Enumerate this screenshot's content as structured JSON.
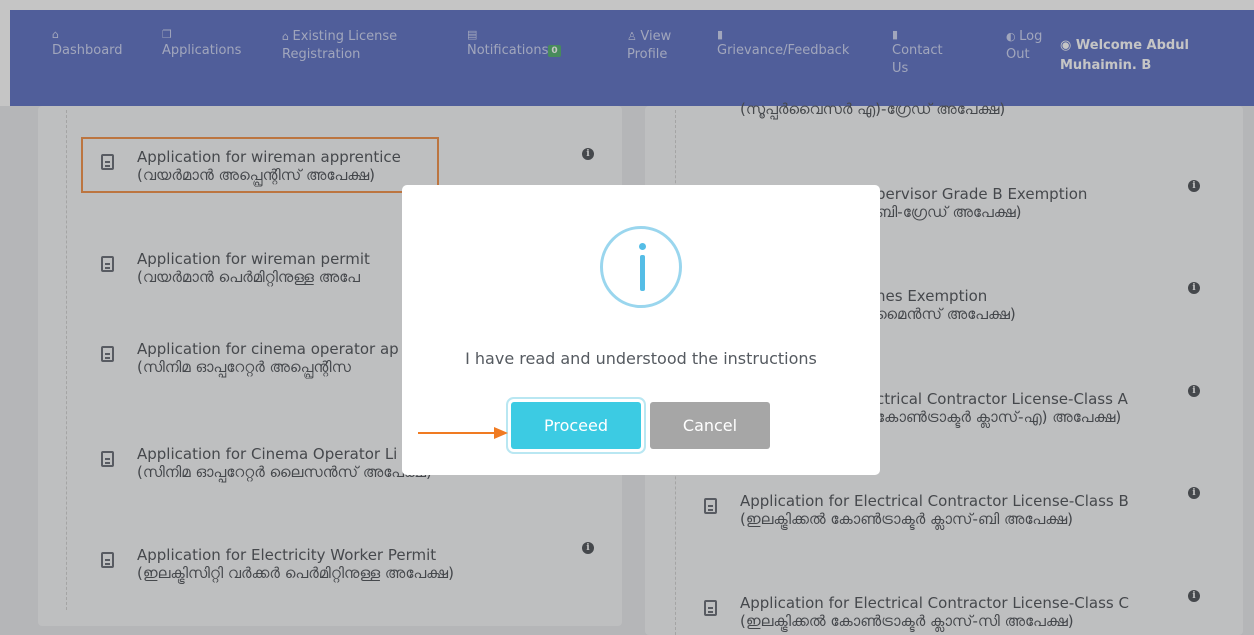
{
  "nav": {
    "dashboard": "Dashboard",
    "applications": "Applications",
    "existing_license": [
      "Existing License",
      "Registration"
    ],
    "notifications": "Notifications",
    "notifications_count": "0",
    "view_profile": [
      "View",
      "Profile"
    ],
    "grievance": "Grievance/Feedback",
    "contact": [
      "Contact",
      "Us"
    ],
    "logout": [
      "Log",
      "Out"
    ],
    "welcome": [
      "Welcome Abdul",
      "Muhaimin. B"
    ]
  },
  "left_items": [
    {
      "en": "Application for wireman apprentice",
      "ml": "(വയർമാൻ അപ്പ്രെന്റിസ് അപേക്ഷ)"
    },
    {
      "en": "Application for wireman permit",
      "ml": "(വയർമാൻ പെർമിറ്റിനുള്ള അപേ"
    },
    {
      "en": "Application for cinema operator ap",
      "ml": "(സിനിമ ഓപ്പറേറ്റർ അപ്പ്രെന്റിസ"
    },
    {
      "en": "Application for Cinema Operator Li",
      "ml": "(സിനിമ ഓപ്പറേറ്റർ ലൈസൻസ് അപേക്ഷ)"
    },
    {
      "en": "Application for Electricity Worker Permit",
      "ml": "(ഇലക്ട്രിസിറ്റി വർക്കർ പെർമിറ്റിനുള്ള അപേക്ഷ)"
    }
  ],
  "right_items": [
    {
      "en": "",
      "ml": "(സൂപ്പർവൈസർ എ)-ഗ്രേഡ് അപേക്ഷ)"
    },
    {
      "en": "pervisor Grade B Exemption",
      "ml": "ബി-ഗ്രേഡ് അപേക്ഷ)"
    },
    {
      "en": "nes Exemption",
      "ml": "മൈൻസ് അപേക്ഷ)"
    },
    {
      "en": "ctrical Contractor License-Class A",
      "ml": "കോൺട്രാക്ടർ ക്ലാസ്-എ) അപേക്ഷ)"
    },
    {
      "en": "Application for Electrical Contractor License-Class B",
      "ml": "(ഇലക്ട്രിക്കൽ കോൺട്രാക്ടർ ക്ലാസ്-ബി അപേക്ഷ)"
    },
    {
      "en": "Application for Electrical Contractor License-Class C",
      "ml": "(ഇലക്ട്രിക്കൽ കോൺട്രാക്ടർ ക്ലാസ്-സി അപേക്ഷ)"
    }
  ],
  "modal": {
    "message": "I have read and understood the instructions",
    "proceed_label": "Proceed",
    "cancel_label": "Cancel"
  },
  "colors": {
    "header": "#3d54b8",
    "highlight": "#f07b22",
    "proceed": "#3ccbe3",
    "cancel": "#a6a6a6",
    "badge": "#2e9e4f"
  }
}
